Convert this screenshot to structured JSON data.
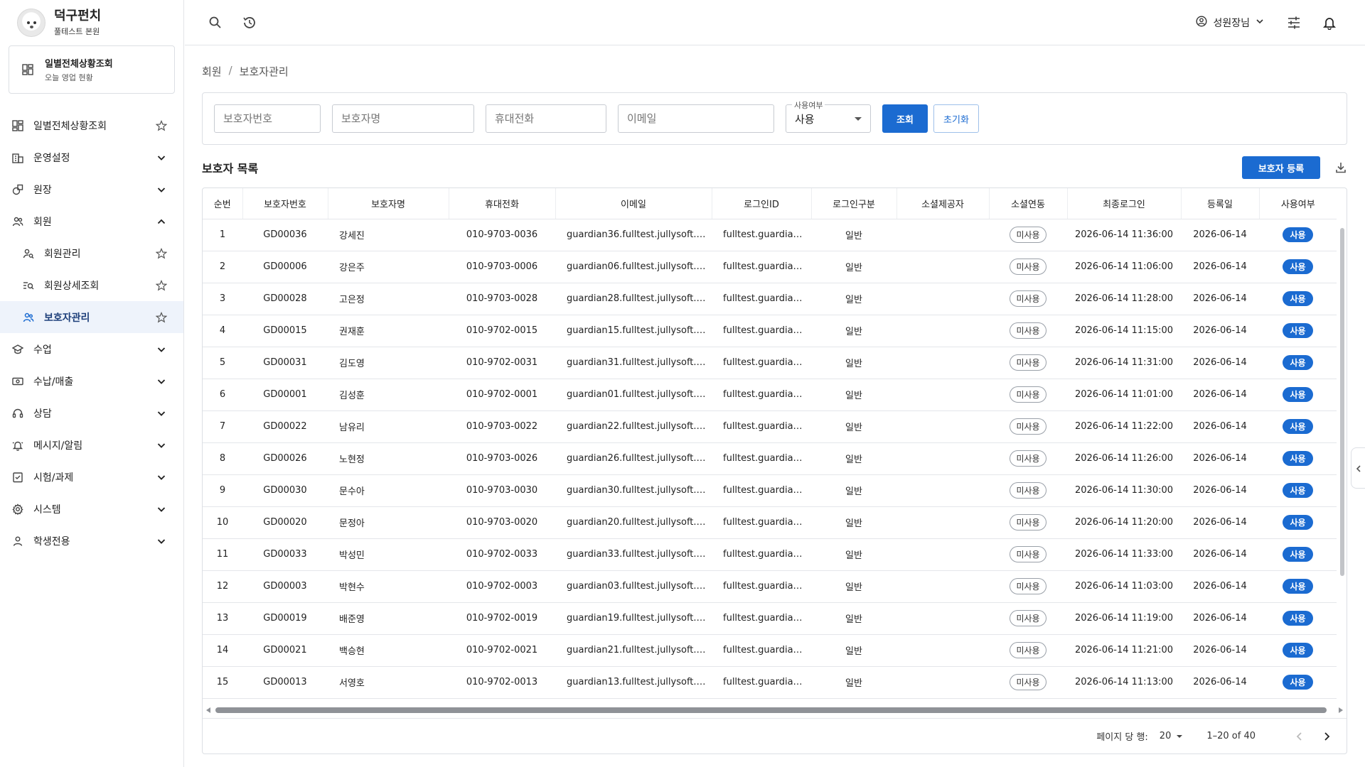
{
  "brand": {
    "name": "덕구펀치",
    "branch": "풀테스트 본원"
  },
  "quick_card": {
    "title": "일별전체상황조회",
    "subtitle": "오늘 영업 현황"
  },
  "nav": [
    {
      "label": "일별전체상황조회",
      "icon": "dashboard-icon",
      "tail": "star",
      "child": false,
      "active": false
    },
    {
      "label": "운영설정",
      "icon": "building-icon",
      "tail": "chevron-down",
      "child": false,
      "active": false
    },
    {
      "label": "원장",
      "icon": "shapes-icon",
      "tail": "chevron-down",
      "child": false,
      "active": false
    },
    {
      "label": "회원",
      "icon": "people-icon",
      "tail": "chevron-up",
      "child": false,
      "active": false
    },
    {
      "label": "회원관리",
      "icon": "person-search-icon",
      "tail": "star",
      "child": true,
      "active": false
    },
    {
      "label": "회원상세조회",
      "icon": "list-search-icon",
      "tail": "star",
      "child": true,
      "active": false
    },
    {
      "label": "보호자관리",
      "icon": "guardian-icon",
      "tail": "star",
      "child": true,
      "active": true
    },
    {
      "label": "수업",
      "icon": "school-icon",
      "tail": "chevron-down",
      "child": false,
      "active": false
    },
    {
      "label": "수납/매출",
      "icon": "payment-icon",
      "tail": "chevron-down",
      "child": false,
      "active": false
    },
    {
      "label": "상담",
      "icon": "headset-icon",
      "tail": "chevron-down",
      "child": false,
      "active": false
    },
    {
      "label": "메시지/알림",
      "icon": "bell-icon",
      "tail": "chevron-down",
      "child": false,
      "active": false
    },
    {
      "label": "시험/과제",
      "icon": "checklist-icon",
      "tail": "chevron-down",
      "child": false,
      "active": false
    },
    {
      "label": "시스템",
      "icon": "gear-icon",
      "tail": "chevron-down",
      "child": false,
      "active": false
    },
    {
      "label": "학생전용",
      "icon": "person-icon",
      "tail": "chevron-down",
      "child": false,
      "active": false
    }
  ],
  "topbar": {
    "user_name": "성원장님"
  },
  "breadcrumb": {
    "parent": "회원",
    "separator": "/",
    "current": "보호자관리"
  },
  "filter": {
    "guardian_no_placeholder": "보호자번호",
    "guardian_name_placeholder": "보호자명",
    "phone_placeholder": "휴대전화",
    "email_placeholder": "이메일",
    "status_label": "사용여부",
    "status_value": "사용",
    "search_label": "조회",
    "reset_label": "초기화"
  },
  "list": {
    "title": "보호자 목록",
    "register_label": "보호자 등록"
  },
  "table": {
    "columns": [
      "순번",
      "보호자번호",
      "보호자명",
      "휴대전화",
      "이메일",
      "로그인ID",
      "로그인구분",
      "소셜제공자",
      "소셜연동",
      "최종로그인",
      "등록일",
      "사용여부"
    ],
    "rows": [
      {
        "no": "1",
        "gid": "GD00036",
        "name": "강세진",
        "phone": "010-9703-0036",
        "email": "guardian36.fulltest.jullysoft.te...",
        "login_id": "fulltest.guardian...",
        "login_type": "일반",
        "social_provider": "",
        "social_link": "미사용",
        "last_login": "2026-06-14 11:36:00",
        "reg_date": "2026-06-14",
        "status": "사용"
      },
      {
        "no": "2",
        "gid": "GD00006",
        "name": "강은주",
        "phone": "010-9703-0006",
        "email": "guardian06.fulltest.jullysoft.te...",
        "login_id": "fulltest.guardian...",
        "login_type": "일반",
        "social_provider": "",
        "social_link": "미사용",
        "last_login": "2026-06-14 11:06:00",
        "reg_date": "2026-06-14",
        "status": "사용"
      },
      {
        "no": "3",
        "gid": "GD00028",
        "name": "고은정",
        "phone": "010-9703-0028",
        "email": "guardian28.fulltest.jullysoft.te...",
        "login_id": "fulltest.guardian...",
        "login_type": "일반",
        "social_provider": "",
        "social_link": "미사용",
        "last_login": "2026-06-14 11:28:00",
        "reg_date": "2026-06-14",
        "status": "사용"
      },
      {
        "no": "4",
        "gid": "GD00015",
        "name": "권재훈",
        "phone": "010-9702-0015",
        "email": "guardian15.fulltest.jullysoft.test",
        "login_id": "fulltest.guardian...",
        "login_type": "일반",
        "social_provider": "",
        "social_link": "미사용",
        "last_login": "2026-06-14 11:15:00",
        "reg_date": "2026-06-14",
        "status": "사용"
      },
      {
        "no": "5",
        "gid": "GD00031",
        "name": "김도영",
        "phone": "010-9702-0031",
        "email": "guardian31.fulltest.jullysoft.test",
        "login_id": "fulltest.guardian...",
        "login_type": "일반",
        "social_provider": "",
        "social_link": "미사용",
        "last_login": "2026-06-14 11:31:00",
        "reg_date": "2026-06-14",
        "status": "사용"
      },
      {
        "no": "6",
        "gid": "GD00001",
        "name": "김성훈",
        "phone": "010-9702-0001",
        "email": "guardian01.fulltest.jullysoft.test",
        "login_id": "fulltest.guardian...",
        "login_type": "일반",
        "social_provider": "",
        "social_link": "미사용",
        "last_login": "2026-06-14 11:01:00",
        "reg_date": "2026-06-14",
        "status": "사용"
      },
      {
        "no": "7",
        "gid": "GD00022",
        "name": "남유리",
        "phone": "010-9703-0022",
        "email": "guardian22.fulltest.jullysoft.te...",
        "login_id": "fulltest.guardian...",
        "login_type": "일반",
        "social_provider": "",
        "social_link": "미사용",
        "last_login": "2026-06-14 11:22:00",
        "reg_date": "2026-06-14",
        "status": "사용"
      },
      {
        "no": "8",
        "gid": "GD00026",
        "name": "노현정",
        "phone": "010-9703-0026",
        "email": "guardian26.fulltest.jullysoft.te...",
        "login_id": "fulltest.guardian...",
        "login_type": "일반",
        "social_provider": "",
        "social_link": "미사용",
        "last_login": "2026-06-14 11:26:00",
        "reg_date": "2026-06-14",
        "status": "사용"
      },
      {
        "no": "9",
        "gid": "GD00030",
        "name": "문수아",
        "phone": "010-9703-0030",
        "email": "guardian30.fulltest.jullysoft.te...",
        "login_id": "fulltest.guardian...",
        "login_type": "일반",
        "social_provider": "",
        "social_link": "미사용",
        "last_login": "2026-06-14 11:30:00",
        "reg_date": "2026-06-14",
        "status": "사용"
      },
      {
        "no": "10",
        "gid": "GD00020",
        "name": "문정아",
        "phone": "010-9703-0020",
        "email": "guardian20.fulltest.jullysoft.te...",
        "login_id": "fulltest.guardian...",
        "login_type": "일반",
        "social_provider": "",
        "social_link": "미사용",
        "last_login": "2026-06-14 11:20:00",
        "reg_date": "2026-06-14",
        "status": "사용"
      },
      {
        "no": "11",
        "gid": "GD00033",
        "name": "박성민",
        "phone": "010-9702-0033",
        "email": "guardian33.fulltest.jullysoft.te...",
        "login_id": "fulltest.guardian...",
        "login_type": "일반",
        "social_provider": "",
        "social_link": "미사용",
        "last_login": "2026-06-14 11:33:00",
        "reg_date": "2026-06-14",
        "status": "사용"
      },
      {
        "no": "12",
        "gid": "GD00003",
        "name": "박현수",
        "phone": "010-9702-0003",
        "email": "guardian03.fulltest.jullysoft.te...",
        "login_id": "fulltest.guardian...",
        "login_type": "일반",
        "social_provider": "",
        "social_link": "미사용",
        "last_login": "2026-06-14 11:03:00",
        "reg_date": "2026-06-14",
        "status": "사용"
      },
      {
        "no": "13",
        "gid": "GD00019",
        "name": "배준영",
        "phone": "010-9702-0019",
        "email": "guardian19.fulltest.jullysoft.test",
        "login_id": "fulltest.guardian...",
        "login_type": "일반",
        "social_provider": "",
        "social_link": "미사용",
        "last_login": "2026-06-14 11:19:00",
        "reg_date": "2026-06-14",
        "status": "사용"
      },
      {
        "no": "14",
        "gid": "GD00021",
        "name": "백승현",
        "phone": "010-9702-0021",
        "email": "guardian21.fulltest.jullysoft.test",
        "login_id": "fulltest.guardian...",
        "login_type": "일반",
        "social_provider": "",
        "social_link": "미사용",
        "last_login": "2026-06-14 11:21:00",
        "reg_date": "2026-06-14",
        "status": "사용"
      },
      {
        "no": "15",
        "gid": "GD00013",
        "name": "서영호",
        "phone": "010-9702-0013",
        "email": "guardian13.fulltest.jullysoft.test",
        "login_id": "fulltest.guardian...",
        "login_type": "일반",
        "social_provider": "",
        "social_link": "미사용",
        "last_login": "2026-06-14 11:13:00",
        "reg_date": "2026-06-14",
        "status": "사용"
      }
    ]
  },
  "pagination": {
    "rows_per_page_label": "페이지 당 행:",
    "rows_per_page": "20",
    "range": "1–20 of 40"
  },
  "colors": {
    "primary": "#1b6bd1",
    "active_nav_bg": "#eef3fb",
    "border": "#dcdfe4"
  }
}
